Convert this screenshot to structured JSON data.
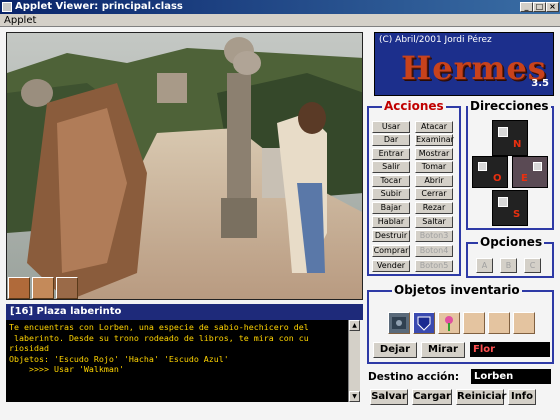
{
  "window": {
    "title": "Applet Viewer: principal.class",
    "menu": "Applet"
  },
  "location": "[16] Plaza laberinto",
  "console_lines": [
    "Te encuentras con Lorben, una especie de sabio-hechicero del",
    " laberinto. Desde su trono rodeado de libros, te mira con cu",
    "riosidad",
    "Objetos: 'Escudo Rojo' 'Hacha' 'Escudo Azul'",
    "    >>>> Usar 'Walkman'"
  ],
  "logo": {
    "copyright": "(C) Abril/2001 Jordi Pérez",
    "name": "Hermes",
    "version": "3.5"
  },
  "acciones": {
    "title": "Acciones",
    "buttons": [
      {
        "label": "Usar",
        "enabled": true
      },
      {
        "label": "Atacar",
        "enabled": true
      },
      {
        "label": "Dar",
        "enabled": true
      },
      {
        "label": "Examinar",
        "enabled": true
      },
      {
        "label": "Entrar",
        "enabled": true
      },
      {
        "label": "Mostrar",
        "enabled": true
      },
      {
        "label": "Salir",
        "enabled": true
      },
      {
        "label": "Tomar",
        "enabled": true
      },
      {
        "label": "Tocar",
        "enabled": true
      },
      {
        "label": "Abrir",
        "enabled": true
      },
      {
        "label": "Subir",
        "enabled": true
      },
      {
        "label": "Cerrar",
        "enabled": true
      },
      {
        "label": "Bajar",
        "enabled": true
      },
      {
        "label": "Rezar",
        "enabled": true
      },
      {
        "label": "Hablar",
        "enabled": true
      },
      {
        "label": "Saltar",
        "enabled": true
      },
      {
        "label": "Destruir",
        "enabled": true
      },
      {
        "label": "Boton3",
        "enabled": false
      },
      {
        "label": "Comprar",
        "enabled": true
      },
      {
        "label": "Boton4",
        "enabled": false
      },
      {
        "label": "Vender",
        "enabled": true
      },
      {
        "label": "Boton5",
        "enabled": false
      }
    ]
  },
  "direcciones": {
    "title": "Direcciones",
    "n": "N",
    "o": "O",
    "e": "E",
    "s": "S"
  },
  "opciones": {
    "title": "Opciones",
    "buttons": [
      "A",
      "B",
      "C"
    ]
  },
  "inventario": {
    "title": "Objetos inventario",
    "dejar": "Dejar",
    "mirar": "Mirar",
    "selected": "Flor"
  },
  "destino": {
    "label": "Destino acción:",
    "value": "Lorben"
  },
  "bottom_buttons": [
    "Salvar",
    "Cargar",
    "Reiniciar",
    "Info"
  ],
  "colors": {
    "accent": "#2e3aa6",
    "title_red": "#c00000",
    "console_text": "#ffd400",
    "location_bar": "#1e2a7a"
  }
}
